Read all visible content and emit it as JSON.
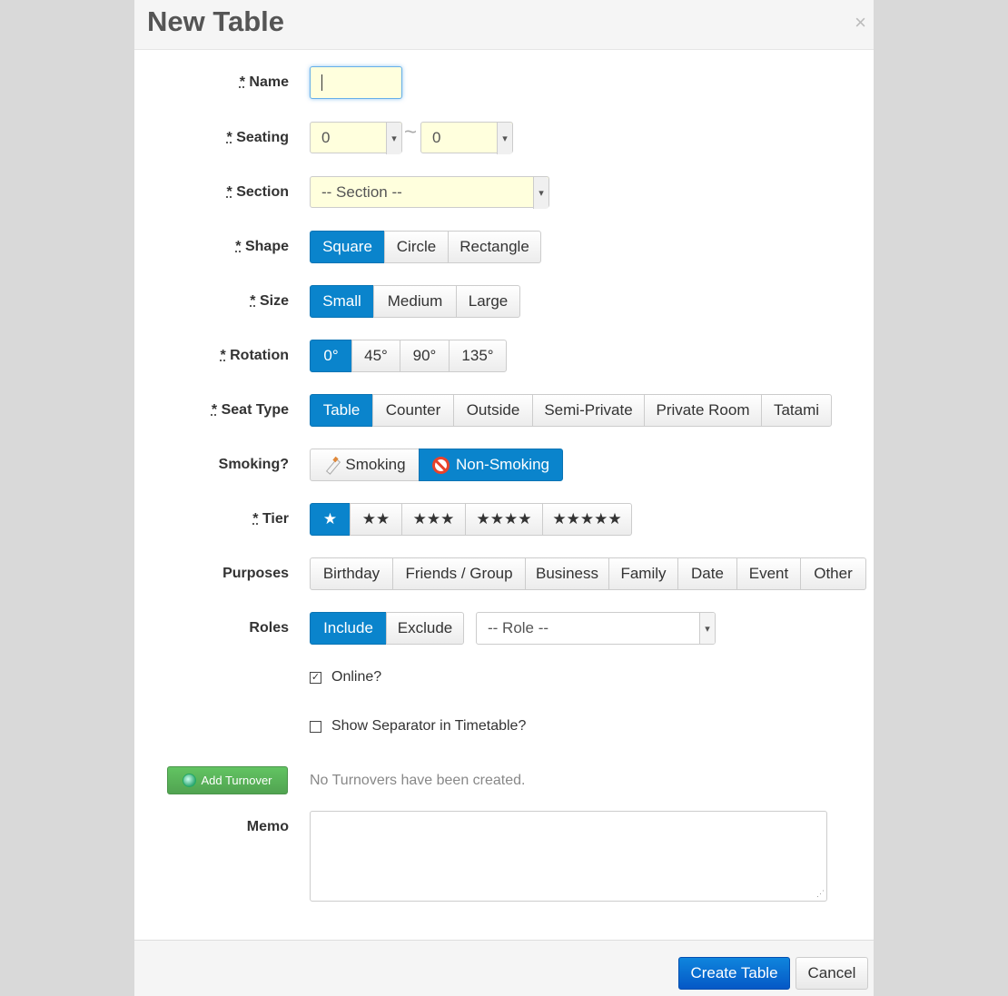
{
  "dialog": {
    "title": "New Table",
    "close_glyph": "×"
  },
  "fields": {
    "name": {
      "label": "Name",
      "required_mark": "*",
      "value": ""
    },
    "seating": {
      "label": "Seating",
      "required_mark": "*",
      "min": "0",
      "max": "0",
      "separator": "~"
    },
    "section": {
      "label": "Section",
      "required_mark": "*",
      "placeholder": "-- Section --"
    },
    "shape": {
      "label": "Shape",
      "required_mark": "*",
      "options": [
        "Square",
        "Circle",
        "Rectangle"
      ],
      "selected": "Square"
    },
    "size": {
      "label": "Size",
      "required_mark": "*",
      "options": [
        "Small",
        "Medium",
        "Large"
      ],
      "selected": "Small"
    },
    "rotation": {
      "label": "Rotation",
      "required_mark": "*",
      "options": [
        "0°",
        "45°",
        "90°",
        "135°"
      ],
      "selected": "0°"
    },
    "seat_type": {
      "label": "Seat Type",
      "required_mark": "*",
      "options": [
        "Table",
        "Counter",
        "Outside",
        "Semi-Private",
        "Private Room",
        "Tatami"
      ],
      "selected": "Table"
    },
    "smoking": {
      "label": "Smoking?",
      "options": [
        "Smoking",
        "Non-Smoking"
      ],
      "selected": "Non-Smoking",
      "icons": [
        "cigarette-icon",
        "no-smoking-icon"
      ]
    },
    "tier": {
      "label": "Tier",
      "required_mark": "*",
      "options": [
        "★",
        "★★",
        "★★★",
        "★★★★",
        "★★★★★"
      ],
      "selected": "★"
    },
    "purposes": {
      "label": "Purposes",
      "options": [
        "Birthday",
        "Friends / Group",
        "Business",
        "Family",
        "Date",
        "Event",
        "Other"
      ]
    },
    "roles": {
      "label": "Roles",
      "options": [
        "Include",
        "Exclude"
      ],
      "selected": "Include",
      "role_placeholder": "-- Role --"
    },
    "online": {
      "label": "Online?",
      "checked": true
    },
    "separator": {
      "label": "Show Separator in Timetable?",
      "checked": false
    },
    "turnover": {
      "button_label": "Add Turnover",
      "empty_text": "No Turnovers have been created."
    },
    "memo": {
      "label": "Memo",
      "value": ""
    }
  },
  "footer": {
    "create_label": "Create Table",
    "cancel_label": "Cancel"
  },
  "colors": {
    "primary": "#0a84cc",
    "success": "#51a351",
    "input_highlight": "#ffffdd"
  }
}
